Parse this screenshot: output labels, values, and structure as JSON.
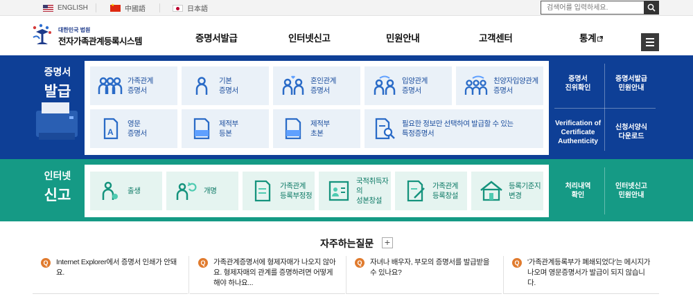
{
  "languages": [
    {
      "label": "ENGLISH",
      "flag": "us-flag-icon"
    },
    {
      "label": "中國語",
      "flag": "china-flag-icon"
    },
    {
      "label": "日本語",
      "flag": "japan-flag-icon"
    }
  ],
  "search": {
    "placeholder": "검색어를 입력하세요."
  },
  "logo": {
    "sub": "대한민국 법원",
    "main": "전자가족관계등록시스템"
  },
  "nav": [
    {
      "label": "증명서발급"
    },
    {
      "label": "인터넷신고"
    },
    {
      "label": "민원안내"
    },
    {
      "label": "고객센터"
    },
    {
      "label": "통계"
    }
  ],
  "issue": {
    "label_line1": "증명서",
    "label_line2": "발급",
    "tiles": [
      {
        "line1": "가족관계",
        "line2": "증명서",
        "icon": "family-icon"
      },
      {
        "line1": "기본",
        "line2": "증명서",
        "icon": "person-icon"
      },
      {
        "line1": "혼인관계",
        "line2": "증명서",
        "icon": "couple-heart-icon"
      },
      {
        "line1": "입양관계",
        "line2": "증명서",
        "icon": "adoption-icon"
      },
      {
        "line1": "친양자입양관계",
        "line2": "증명서",
        "icon": "full-adoption-icon"
      },
      {
        "line1": "영문",
        "line2": "증명서",
        "icon": "english-document-icon"
      },
      {
        "line1": "제적부",
        "line2": "등본",
        "icon": "removed-register-icon"
      },
      {
        "line1": "제적부",
        "line2": "초본",
        "icon": "removed-register-extract-icon"
      },
      {
        "line1": "필요한 정보만 선택하여 발급할 수 있는",
        "line2": "특정증명서",
        "icon": "document-search-icon"
      }
    ],
    "side": [
      {
        "line1": "증명서",
        "line2": "진위확인"
      },
      {
        "line1": "증명서발급",
        "line2": "민원안내"
      },
      {
        "line1": "Verification of",
        "line2": "Certificate",
        "line3": "Authenticity"
      },
      {
        "line1": "신청서양식",
        "line2": "다운로드"
      }
    ]
  },
  "report": {
    "label_line1": "인터넷",
    "label_line2": "신고",
    "tiles": [
      {
        "line1": "출생",
        "line2": "",
        "icon": "birth-icon"
      },
      {
        "line1": "개명",
        "line2": "",
        "icon": "rename-icon"
      },
      {
        "line1": "가족관계",
        "line2": "등록부정정",
        "icon": "register-correction-icon"
      },
      {
        "line1": "국적취득자의",
        "line2": "성본창설",
        "icon": "naturalized-id-icon"
      },
      {
        "line1": "가족관계",
        "line2": "등록창설",
        "icon": "register-create-icon"
      },
      {
        "line1": "등록기준지",
        "line2": "변경",
        "icon": "house-icon"
      }
    ],
    "side": [
      {
        "line1": "처리내역",
        "line2": "확인"
      },
      {
        "line1": "인터넷신고",
        "line2": "민원안내"
      }
    ]
  },
  "faq": {
    "title": "자주하는질문",
    "more": "+",
    "badge": "Q",
    "items": [
      {
        "text": "Internet Explorer에서 증명서 인쇄가 안돼요."
      },
      {
        "text": "가족관계증명서에 형제자매가 나오지 않아요. 형제자매의 관계를 증명하려면 어떻게 해야 하나요..."
      },
      {
        "text": "자녀나 배우자, 부모의 증명서를 발급받을 수 있나요?"
      },
      {
        "text": "'가족관계등록부가 폐쇄되었다'는 메시지가 나오며 영문증명서가 발급이 되지 않습니다."
      }
    ]
  },
  "colors": {
    "issue_bg": "#0e3f96",
    "report_bg": "#159a85",
    "issue_tile": "#eaf1f8",
    "report_tile": "#e5f4f0",
    "faq_badge": "#e07b2e"
  }
}
